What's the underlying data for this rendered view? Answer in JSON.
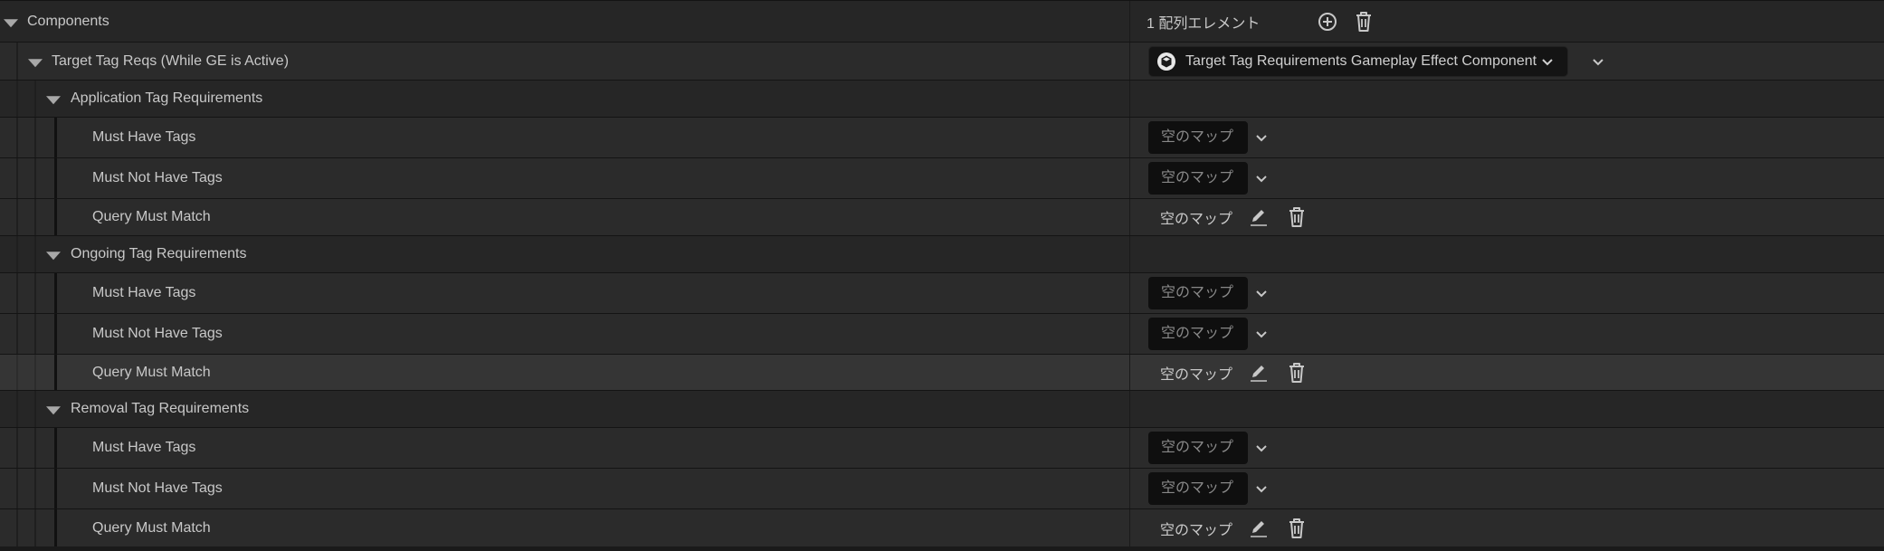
{
  "components": {
    "label": "Components",
    "count_text": "1 配列エレメント",
    "item": {
      "label": "Target Tag Reqs (While GE is Active)",
      "class_name": "Target Tag Requirements Gameplay Effect Component"
    }
  },
  "groups": [
    {
      "label": "Application Tag Requirements",
      "must_have": {
        "label": "Must Have Tags",
        "value": "空のマップ"
      },
      "must_not_have": {
        "label": "Must Not Have Tags",
        "value": "空のマップ"
      },
      "query": {
        "label": "Query Must Match",
        "value": "空のマップ"
      }
    },
    {
      "label": "Ongoing Tag Requirements",
      "must_have": {
        "label": "Must Have Tags",
        "value": "空のマップ"
      },
      "must_not_have": {
        "label": "Must Not Have Tags",
        "value": "空のマップ"
      },
      "query": {
        "label": "Query Must Match",
        "value": "空のマップ"
      }
    },
    {
      "label": "Removal Tag Requirements",
      "must_have": {
        "label": "Must Have Tags",
        "value": "空のマップ"
      },
      "must_not_have": {
        "label": "Must Not Have Tags",
        "value": "空のマップ"
      },
      "query": {
        "label": "Query Must Match",
        "value": "空のマップ"
      }
    }
  ],
  "icons": {
    "expand": "triangle-down-icon",
    "add": "plus-circle-icon",
    "delete": "trash-icon",
    "edit": "pencil-icon",
    "dropdown": "chevron-down-icon",
    "class": "component-cube-icon"
  },
  "colors": {
    "background": "#2b2b2b",
    "category_background": "#262626",
    "field_background": "#0f0f0f",
    "text": "#c8c8c8",
    "placeholder_text": "#888888"
  }
}
